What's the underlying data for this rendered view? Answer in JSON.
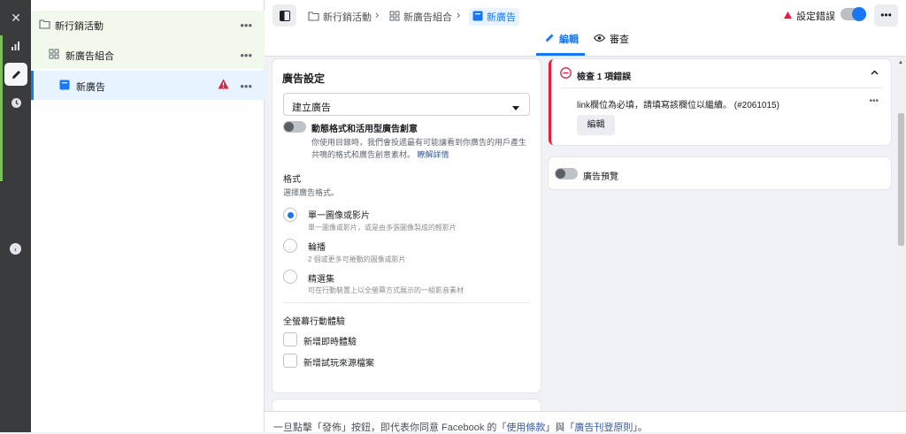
{
  "tree": {
    "campaign": "新行銷活動",
    "adset": "新廣告組合",
    "ad": "新廣告",
    "more": "•••"
  },
  "breadcrumb": {
    "campaign": "新行銷活動",
    "adset": "新廣告組合",
    "ad": "新廣告"
  },
  "header": {
    "error_label": "設定錯誤",
    "more": "•••"
  },
  "tabs": {
    "edit": "編輯",
    "review": "審查"
  },
  "ad_settings": {
    "title": "廣告設定",
    "create_select": "建立廣告",
    "dynamic_title": "動態格式和活用型廣告創意",
    "dynamic_desc": "你使用目錄時，我們會投遞最有可能讓看到你廣告的用戶產生共鳴的格式和廣告創意素材。",
    "learn_more": "瞭解詳情",
    "format_title": "格式",
    "format_desc": "選擇廣告格式。",
    "options": [
      {
        "label": "單一圖像或影片",
        "desc": "單一圖像或影片，或是由多張圖像製成的輕影片"
      },
      {
        "label": "輪播",
        "desc": "2 個或更多可捲動的圖像或影片"
      },
      {
        "label": "精選集",
        "desc": "可在行動裝置上以全螢幕方式展示的一組影音素材"
      }
    ],
    "fullscreen_title": "全螢幕行動體驗",
    "instant_label": "新增即時體驗",
    "playable_label": "新增試玩來源檔案"
  },
  "errors": {
    "title": "檢查 1 項錯誤",
    "message": "link欄位為必填，請填寫該欄位以繼續。 (#2061015)",
    "edit_button": "編輯",
    "more": "•••"
  },
  "preview": {
    "label": "廣告預覽"
  },
  "footer": {
    "prefix": "一旦點擊「發佈」按鈕，即代表你同意 Facebook 的「",
    "terms": "使用條款",
    "middle": "」與「",
    "policy": "廣告刊登原則",
    "suffix": "」。"
  },
  "colors": {
    "accent": "#1877f2",
    "error": "#e41e3f",
    "selected_bg": "#e7f3ff",
    "tree_top_bg": "#f1f8ec"
  }
}
